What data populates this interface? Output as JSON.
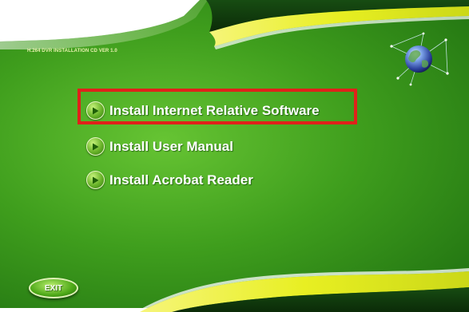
{
  "header": {
    "version_label": "H.264 DVR INSTALLATION CD VER 1.0"
  },
  "menu": {
    "items": [
      {
        "label": "Install Internet Relative Software",
        "icon": "play-icon",
        "highlighted": true
      },
      {
        "label": "Install User Manual",
        "icon": "play-icon",
        "highlighted": false
      },
      {
        "label": "Install Acrobat Reader",
        "icon": "play-icon",
        "highlighted": false
      }
    ]
  },
  "footer": {
    "exit_label": "EXIT"
  },
  "colors": {
    "background": "#3f9e1d",
    "accent_yellow": "#e8ef22",
    "dark_band": "#0f3a0c",
    "highlight_border": "#e0211a",
    "text": "#ffffff"
  },
  "icons": {
    "globe": "globe-icon",
    "play": "play-icon"
  }
}
